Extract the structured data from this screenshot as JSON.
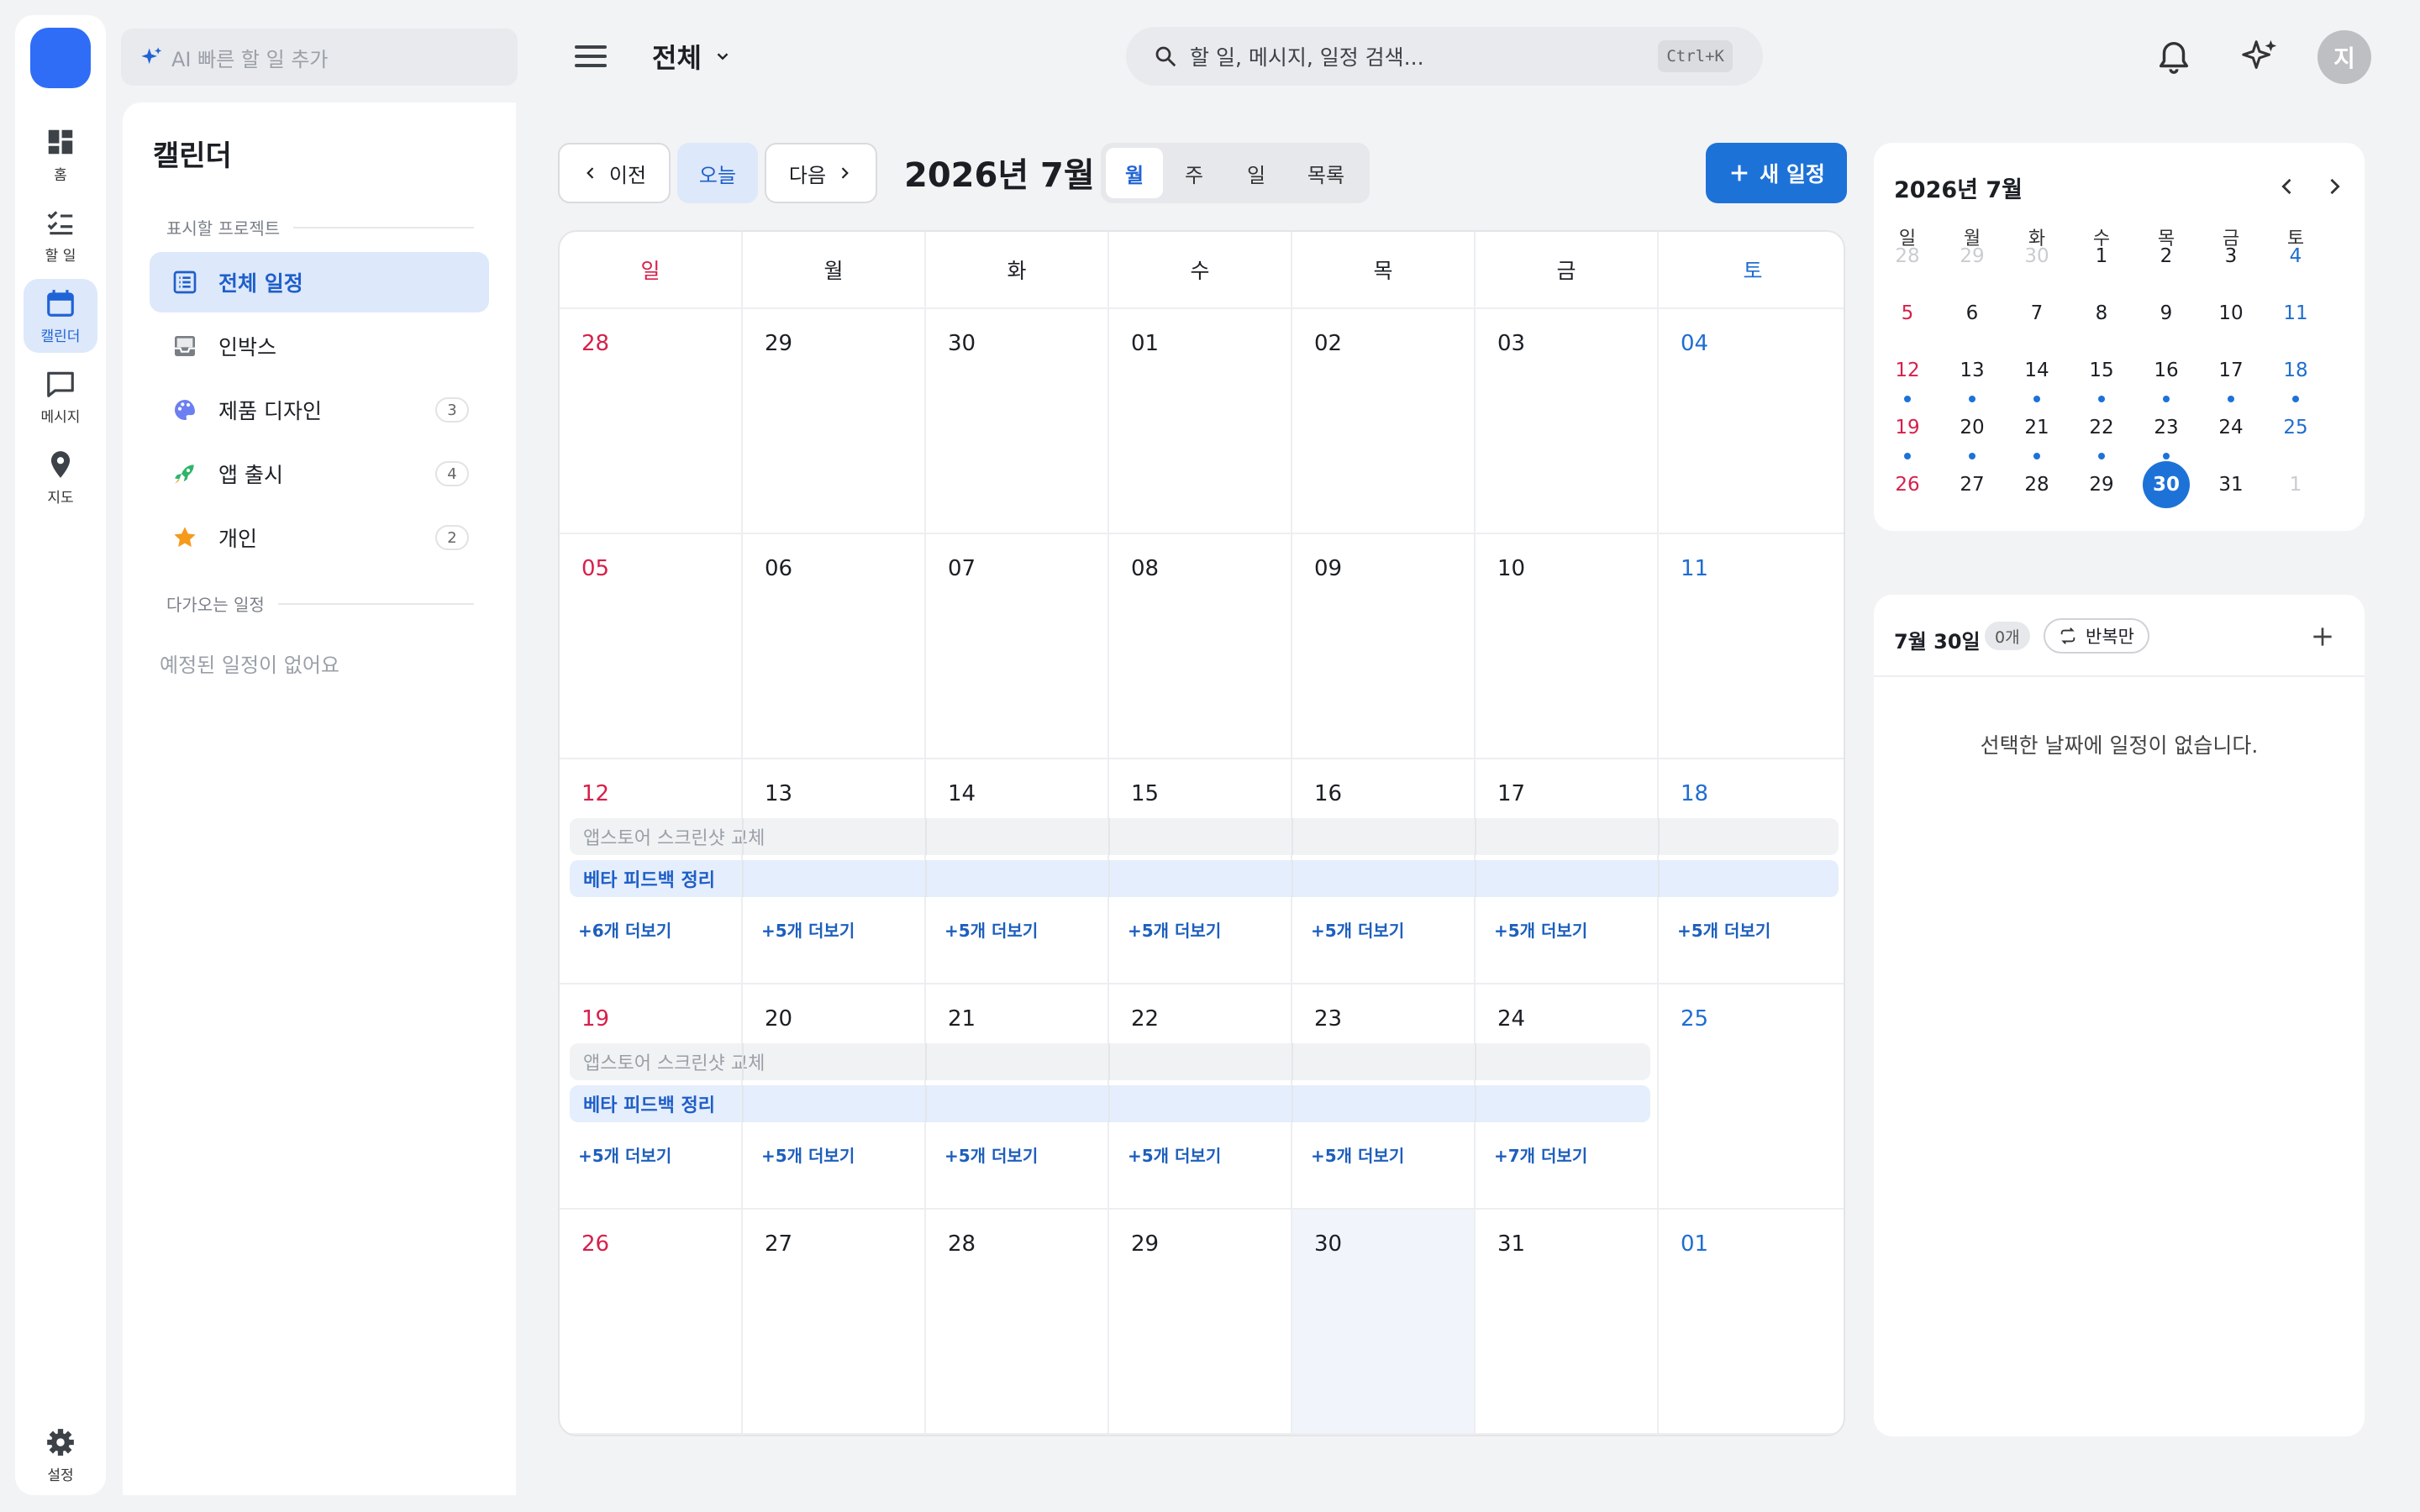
{
  "rail": {
    "items": [
      {
        "label": "홈"
      },
      {
        "label": "할 일"
      },
      {
        "label": "캘린더"
      },
      {
        "label": "메시지"
      },
      {
        "label": "지도"
      }
    ],
    "settings_label": "설정"
  },
  "topbar": {
    "ai_placeholder": "AI 빠른 할 일 추가",
    "scope_label": "전체",
    "search_placeholder": "할 일, 메시지, 일정 검색...",
    "search_shortcut": "Ctrl+K",
    "avatar_initial": "지"
  },
  "sidebar": {
    "title": "캘린더",
    "projects_title": "표시할 프로젝트",
    "projects": [
      {
        "name": "전체 일정",
        "count": ""
      },
      {
        "name": "인박스",
        "count": ""
      },
      {
        "name": "제품 디자인",
        "count": "3"
      },
      {
        "name": "앱 출시",
        "count": "4"
      },
      {
        "name": "개인",
        "count": "2"
      }
    ],
    "upcoming_title": "다가오는 일정",
    "upcoming_empty": "예정된 일정이 없어요"
  },
  "toolbar": {
    "prev": "이전",
    "today": "오늘",
    "next": "다음",
    "month_title": "2026년 7월",
    "views": [
      "월",
      "주",
      "일",
      "목록"
    ],
    "new_event": "새 일정"
  },
  "calendar": {
    "weekdays": [
      "일",
      "월",
      "화",
      "수",
      "목",
      "금",
      "토"
    ],
    "weeks": [
      {
        "days": [
          "28",
          "29",
          "30",
          "01",
          "02",
          "03",
          "04"
        ],
        "more": [
          "",
          "",
          "",
          "",
          "",
          "",
          ""
        ]
      },
      {
        "days": [
          "05",
          "06",
          "07",
          "08",
          "09",
          "10",
          "11"
        ],
        "more": [
          "",
          "",
          "",
          "",
          "",
          "",
          ""
        ]
      },
      {
        "days": [
          "12",
          "13",
          "14",
          "15",
          "16",
          "17",
          "18"
        ],
        "more": [
          "+6개 더보기",
          "+5개 더보기",
          "+5개 더보기",
          "+5개 더보기",
          "+5개 더보기",
          "+5개 더보기",
          "+5개 더보기"
        ]
      },
      {
        "days": [
          "19",
          "20",
          "21",
          "22",
          "23",
          "24",
          "25"
        ],
        "more": [
          "+5개 더보기",
          "+5개 더보기",
          "+5개 더보기",
          "+5개 더보기",
          "+5개 더보기",
          "+7개 더보기",
          ""
        ]
      },
      {
        "days": [
          "26",
          "27",
          "28",
          "29",
          "30",
          "31",
          "01"
        ],
        "more": [
          "",
          "",
          "",
          "",
          "",
          "",
          ""
        ]
      }
    ],
    "events": {
      "gray": "앱스토어 스크린샷 교체",
      "blue": "베타 피드백 정리"
    }
  },
  "mini_calendar": {
    "title": "2026년 7월",
    "weekdays": [
      "일",
      "월",
      "화",
      "수",
      "목",
      "금",
      "토"
    ],
    "weeks": [
      [
        "28",
        "29",
        "30",
        "1",
        "2",
        "3",
        "4"
      ],
      [
        "5",
        "6",
        "7",
        "8",
        "9",
        "10",
        "11"
      ],
      [
        "12",
        "13",
        "14",
        "15",
        "16",
        "17",
        "18"
      ],
      [
        "19",
        "20",
        "21",
        "22",
        "23",
        "24",
        "25"
      ],
      [
        "26",
        "27",
        "28",
        "29",
        "30",
        "31",
        "1"
      ]
    ],
    "selected": "30"
  },
  "day_panel": {
    "date": "7월 30일",
    "count": "0개",
    "repeat_filter": "반복만",
    "empty": "선택한 날짜에 일정이 없습니다."
  },
  "colors": {
    "accent": "#1d72d8",
    "sunday": "#d6204a",
    "saturday": "#1f6dd1"
  }
}
